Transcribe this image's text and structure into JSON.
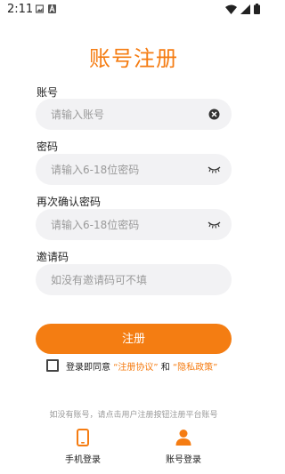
{
  "status_bar": {
    "time": "2:11",
    "icons": [
      "image-icon",
      "a-icon",
      "wifi-icon",
      "signal-icon",
      "battery-icon"
    ]
  },
  "page": {
    "title": "账号注册",
    "accent_color": "#f57c12"
  },
  "form": {
    "account": {
      "label": "账号",
      "placeholder": "请输入账号",
      "value": "",
      "action_icon": "clear-icon"
    },
    "password": {
      "label": "密码",
      "placeholder": "请输入6-18位密码",
      "value": "",
      "action_icon": "eye-closed-icon"
    },
    "confirm_password": {
      "label": "再次确认密码",
      "placeholder": "请输入6-18位密码",
      "value": "",
      "action_icon": "eye-closed-icon"
    },
    "invite_code": {
      "label": "邀请码",
      "placeholder": "如没有邀请码可不填",
      "value": ""
    }
  },
  "register_button": {
    "label": "注册"
  },
  "agreement": {
    "checked": false,
    "prefix": "登录即同意",
    "user_agreement": "“注册协议”",
    "and": "和",
    "privacy_policy": "“隐私政策”"
  },
  "hint": "如没有账号，请点击用户注册按钮注册平台账号",
  "bottom_tabs": [
    {
      "label": "手机登录",
      "icon": "phone-icon"
    },
    {
      "label": "账号登录",
      "icon": "user-icon"
    }
  ]
}
